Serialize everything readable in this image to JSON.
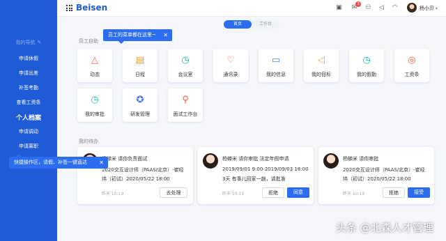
{
  "app": {
    "logo": "Beisen"
  },
  "colors": {
    "brand": "#1f5bd6",
    "accent": "#2d6ef0",
    "badge": "#f04848"
  },
  "header": {
    "icons": [
      "doc-icon",
      "mail-icon",
      "person-icon",
      "speaker-icon",
      "headset-icon",
      "bell-icon"
    ],
    "mail_badge": "3",
    "user_name": "杨小贝"
  },
  "tabs": [
    {
      "label": "首页",
      "active": true
    },
    {
      "label": "工作台",
      "active": false
    }
  ],
  "sidebar": {
    "section_title": "我的导航",
    "items": [
      {
        "label": "申请休假"
      },
      {
        "label": "申请出差"
      },
      {
        "label": "补签考勤"
      },
      {
        "label": "查看工资条"
      },
      {
        "label": "个人档案"
      },
      {
        "label": "申请调动"
      },
      {
        "label": "申请离职"
      }
    ]
  },
  "tooltips": {
    "menu_tip": "员工的菜单都在这里~",
    "quick_tip": "快捷操作区，请假、补签一键直达"
  },
  "self_service": {
    "label": "员工自助",
    "tiles": [
      {
        "label": "动态",
        "icon": "flame-icon",
        "color": "#f05a3c",
        "glyph": "△"
      },
      {
        "label": "日程",
        "icon": "calendar-icon",
        "color": "#f0a030",
        "glyph": "▤"
      },
      {
        "label": "会议室",
        "icon": "clock-icon",
        "color": "#18b8a8",
        "glyph": "◷"
      },
      {
        "label": "通讯录",
        "icon": "heart-icon",
        "color": "#f05a5a",
        "glyph": "♡"
      },
      {
        "label": "我的信息",
        "icon": "chat-icon",
        "color": "#3a8ef0",
        "glyph": "▭"
      },
      {
        "label": "我的目标",
        "icon": "megaphone-icon",
        "color": "#f0a030",
        "glyph": "◁"
      },
      {
        "label": "我的假勤",
        "icon": "alarm-icon",
        "color": "#18b8a8",
        "glyph": "◷"
      },
      {
        "label": "工资条",
        "icon": "spiral-icon",
        "color": "#f06030",
        "glyph": "◎"
      },
      {
        "label": "我的审批",
        "icon": "alarm-icon",
        "color": "#18b8a8",
        "glyph": "◷"
      },
      {
        "label": "研发管理",
        "icon": "compass-icon",
        "color": "#3a6ef0",
        "glyph": "✪"
      },
      {
        "label": "面试工作台",
        "icon": "interviewer-icon",
        "color": "#f06040",
        "glyph": "⚲"
      }
    ]
  },
  "todo": {
    "label": "我的待办",
    "cards": [
      {
        "title": "杨蝉米  请你负责面试",
        "line1": "2020交互设计师（PAAS/北京）-崔经",
        "line2": "纬（初试）2020/05/22 18:00",
        "time": "昨天 10:19",
        "buttons": [
          {
            "label": "去处理",
            "style": "ghost"
          }
        ]
      },
      {
        "title": "杨蝉米  请你审批  法定年假申请",
        "line1": "2019/09/01 9:00-2019/09/03 18:00",
        "line2": "3天 有事儿回家一趟，请批准",
        "time": "昨天 10:19",
        "buttons": [
          {
            "label": "拒绝",
            "style": "ghost"
          },
          {
            "label": "同意",
            "style": "primary"
          }
        ]
      },
      {
        "title": "杨蝉米  请你审批",
        "line1": "2020交互设计师（PAAS/北京）-崔经",
        "line2": "纬（初试）2020/05/22 18:00",
        "time": "昨天 10:19",
        "buttons": [
          {
            "label": "拒绝",
            "style": "ghost"
          },
          {
            "label": "接受",
            "style": "primary"
          }
        ]
      }
    ]
  },
  "watermark": "头条 @北森人才管理"
}
